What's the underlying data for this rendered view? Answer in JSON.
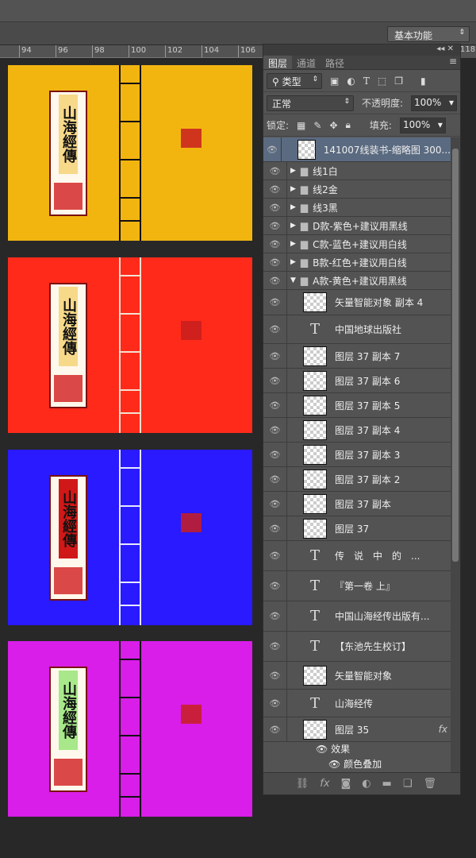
{
  "workspace": "基本功能",
  "ruler": [
    "94",
    "96",
    "98",
    "100",
    "102",
    "104",
    "106",
    "118"
  ],
  "covers": [
    {
      "bg": "#f2b510",
      "line": "#111111",
      "title_bg": "#f7d98a",
      "title": "山海經傳"
    },
    {
      "bg": "#ff2a1a",
      "line": "#f4e0d0",
      "title_bg": "#f7d98a",
      "title": "山海經傳"
    },
    {
      "bg": "#2a1aff",
      "line": "#e8e8ff",
      "title_bg": "#d01818",
      "title": "山海經傳"
    },
    {
      "bg": "#d81ee8",
      "line": "#111111",
      "title_bg": "#a8e88a",
      "title": "山海經傳"
    }
  ],
  "panel": {
    "tabs": [
      "图层",
      "通道",
      "路径"
    ],
    "filter": "类型",
    "blend": "正常",
    "opacity_label": "不透明度:",
    "opacity": "100%",
    "lock_label": "锁定:",
    "fill_label": "填充:",
    "fill": "100%",
    "layers": [
      {
        "name": "141007线装书-缩略图 300...",
        "type": "smart",
        "selected": true
      },
      {
        "name": "线1白",
        "type": "group"
      },
      {
        "name": "线2金",
        "type": "group"
      },
      {
        "name": "线3黑",
        "type": "group"
      },
      {
        "name": "D款-紫色+建议用黑线",
        "type": "group"
      },
      {
        "name": "C款-蓝色+建议用白线",
        "type": "group"
      },
      {
        "name": "B款-红色+建议用白线",
        "type": "group"
      },
      {
        "name": "A款-黄色+建议用黑线",
        "type": "group-open"
      },
      {
        "name": "矢量智能对象 副本 4",
        "type": "smart"
      },
      {
        "name": "中国地球出版社",
        "type": "text"
      },
      {
        "name": "图层 37 副本 7",
        "type": "pixel"
      },
      {
        "name": "图层 37 副本 6",
        "type": "pixel"
      },
      {
        "name": "图层 37 副本 5",
        "type": "pixel"
      },
      {
        "name": "图层 37 副本 4",
        "type": "pixel"
      },
      {
        "name": "图层 37 副本 3",
        "type": "pixel"
      },
      {
        "name": "图层 37 副本 2",
        "type": "pixel"
      },
      {
        "name": "图层 37 副本",
        "type": "pixel"
      },
      {
        "name": "图层 37",
        "type": "pixel"
      },
      {
        "name": "传　说　中　的　...",
        "type": "text"
      },
      {
        "name": "『第一卷 上』",
        "type": "text"
      },
      {
        "name": "中国山海经传出版有...",
        "type": "text"
      },
      {
        "name": "【东池先生校订】",
        "type": "text"
      },
      {
        "name": "矢量智能对象",
        "type": "smart"
      },
      {
        "name": "山海经传",
        "type": "text"
      },
      {
        "name": "图层 35",
        "type": "pixel",
        "fx": true
      }
    ],
    "effects_label": "效果",
    "effect": "颜色叠加"
  }
}
